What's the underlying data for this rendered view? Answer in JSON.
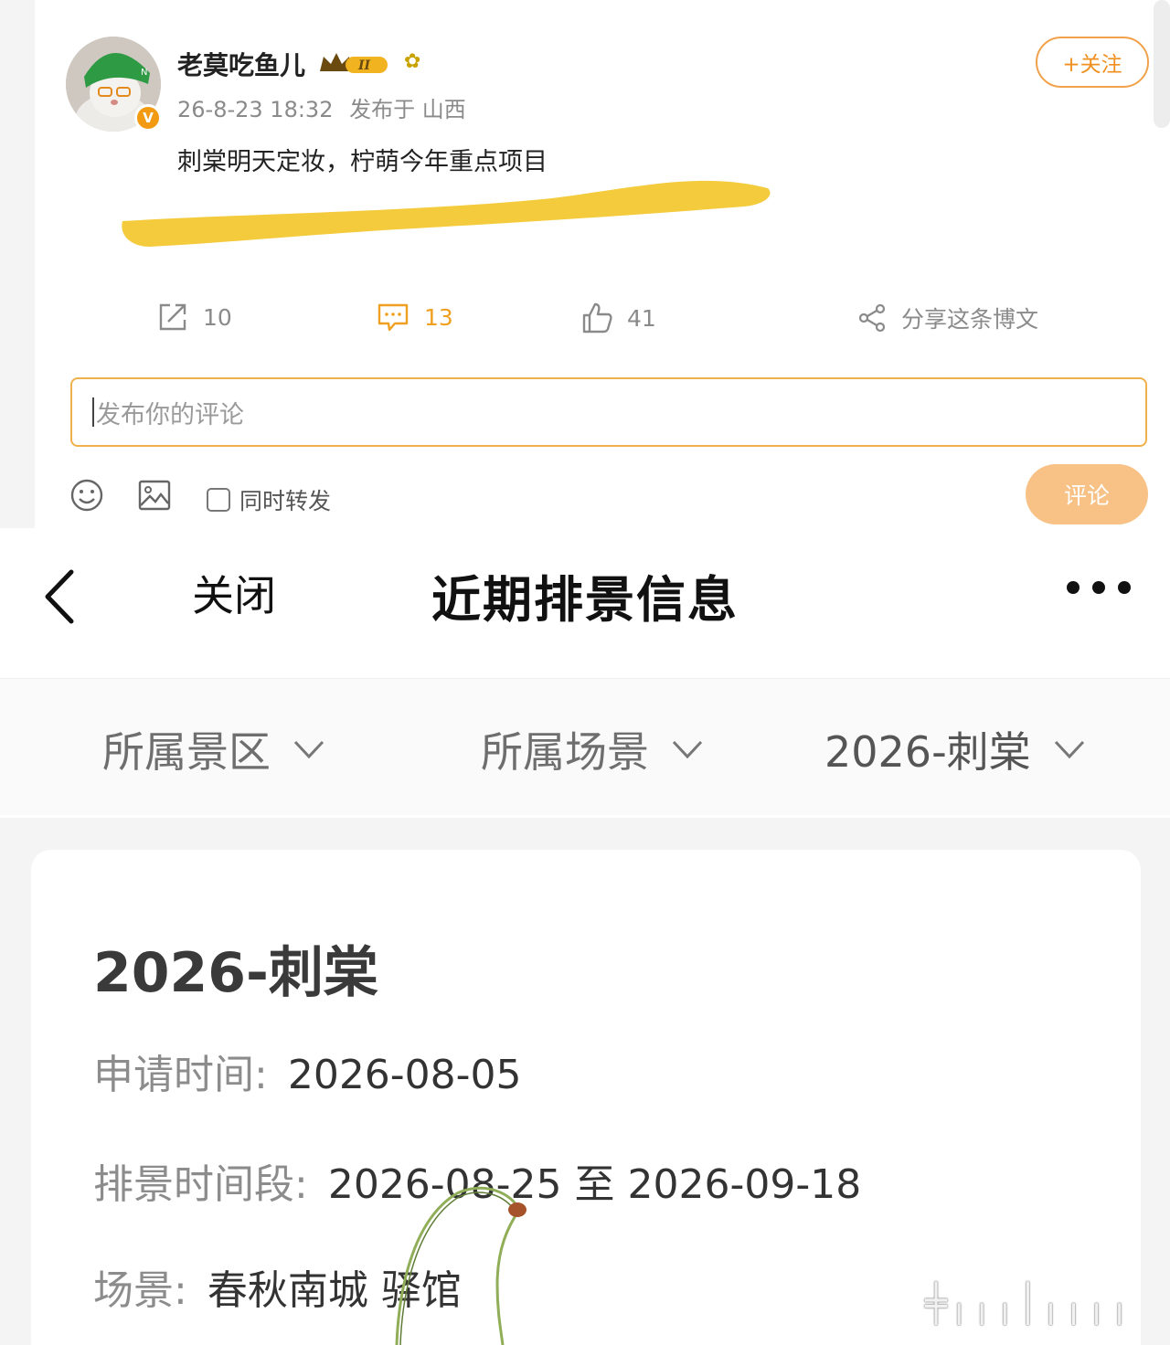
{
  "post": {
    "username": "老莫吃鱼儿",
    "level_badge": "II",
    "verified_mark": "V",
    "timestamp": "26-8-23 18:32",
    "published_from": "发布于 山西",
    "text": "刺棠明天定妆，柠萌今年重点项目",
    "follow_label": "+关注",
    "repost_count": "10",
    "comment_count": "13",
    "like_count": "41",
    "share_label": "分享这条博文",
    "comment_placeholder": "发布你的评论",
    "repost_toggle_label": "同时转发",
    "submit_label": "评论",
    "colors": {
      "accent": "#f18f1f",
      "submit_bg": "#f8c186",
      "highlight": "#f2c21b"
    },
    "icons": [
      "emoji-icon",
      "image-icon",
      "repost-icon",
      "comment-icon",
      "like-icon",
      "share-icon",
      "crown-icon",
      "flower-icon"
    ]
  },
  "schedule": {
    "close_label": "关闭",
    "title": "近期排景信息",
    "filters": [
      {
        "label": "所属景区"
      },
      {
        "label": "所属场景"
      },
      {
        "label": "2026-刺棠"
      }
    ],
    "card": {
      "title": "2026-刺棠",
      "apply_time_label": "申请时间:",
      "apply_time_value": "2026-08-05",
      "period_label": "排景时间段:",
      "period_value": "2026-08-25 至 2026-09-18",
      "scene_label": "场景:",
      "scene_value": "春秋南城 驿馆"
    }
  }
}
